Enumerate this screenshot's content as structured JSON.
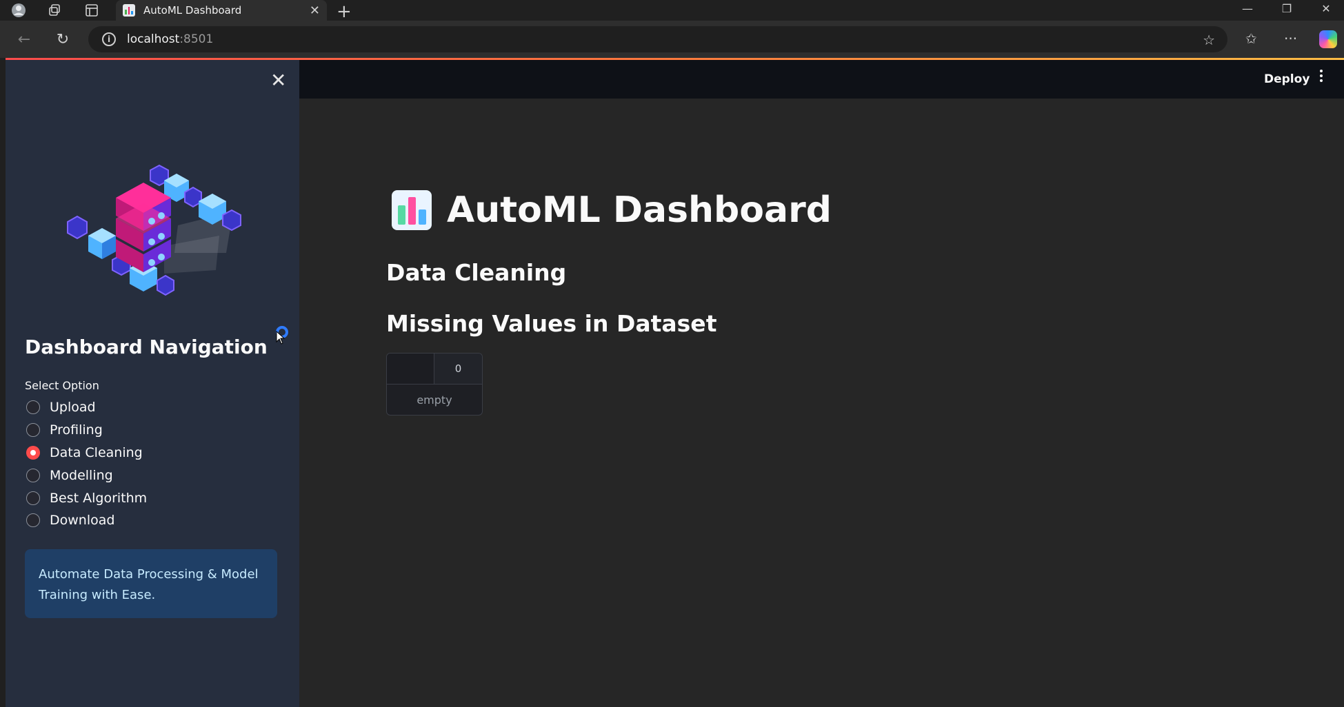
{
  "browser": {
    "tab_title": "AutoML Dashboard",
    "address_host": "localhost",
    "address_port": ":8501"
  },
  "header": {
    "deploy_label": "Deploy"
  },
  "sidebar": {
    "heading": "Dashboard Navigation",
    "select_label": "Select Option",
    "options": [
      {
        "label": "Upload",
        "selected": false
      },
      {
        "label": "Profiling",
        "selected": false
      },
      {
        "label": "Data Cleaning",
        "selected": true
      },
      {
        "label": "Modelling",
        "selected": false
      },
      {
        "label": "Best Algorithm",
        "selected": false
      },
      {
        "label": "Download",
        "selected": false
      }
    ],
    "info_text": "Automate Data Processing & Model Training with Ease."
  },
  "main": {
    "title": "AutoML Dashboard",
    "section": "Data Cleaning",
    "subsection": "Missing Values in Dataset",
    "table": {
      "column_header": "0",
      "empty_text": "empty"
    }
  },
  "colors": {
    "accent": "#ff4b4b",
    "sidebar_bg": "#262e3e",
    "main_bg": "#262626",
    "header_bg": "#0e1117",
    "info_bg": "#1f3f66"
  }
}
